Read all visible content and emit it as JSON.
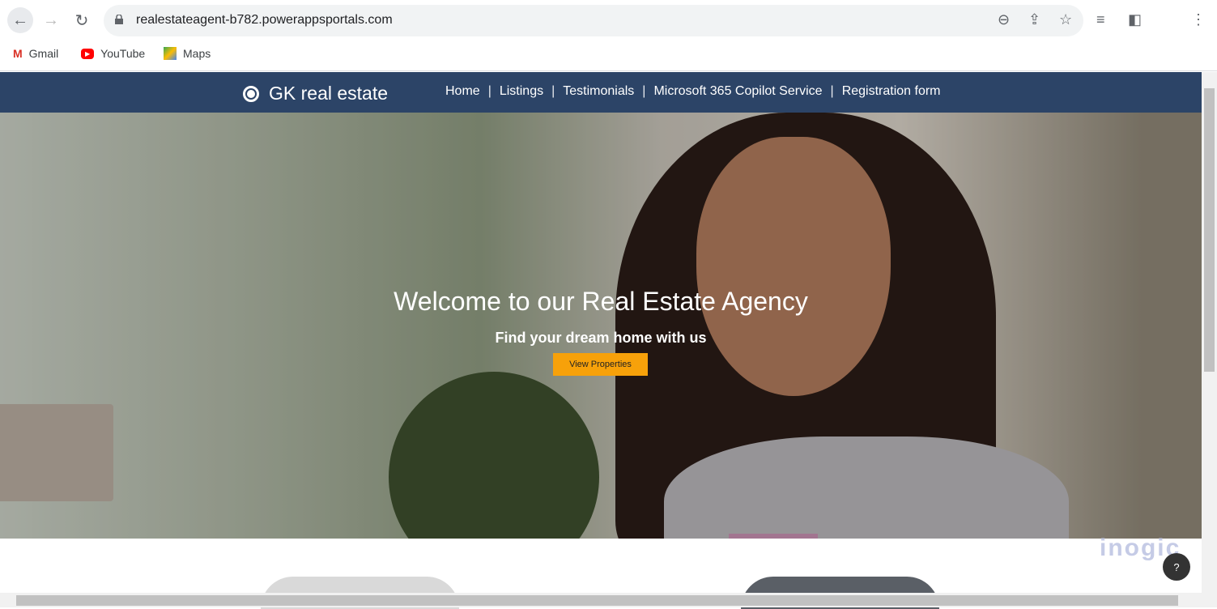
{
  "browser": {
    "url": "realestateagent-b782.powerappsportals.com",
    "bookmarks": [
      {
        "label": "Gmail"
      },
      {
        "label": "YouTube"
      },
      {
        "label": "Maps"
      }
    ]
  },
  "site": {
    "brand": "GK real estate",
    "nav": [
      {
        "label": "Home"
      },
      {
        "label": "Listings"
      },
      {
        "label": "Testimonials"
      },
      {
        "label": "Microsoft 365 Copilot Service"
      },
      {
        "label": "Registration form"
      }
    ],
    "separator": "|",
    "hero": {
      "title": "Welcome to our Real Estate Agency",
      "subtitle": "Find your dream home with us",
      "cta": "View Properties"
    },
    "colors": {
      "nav_bg": "#2c4467",
      "cta": "#f7a10a"
    }
  },
  "watermark": "inogic"
}
